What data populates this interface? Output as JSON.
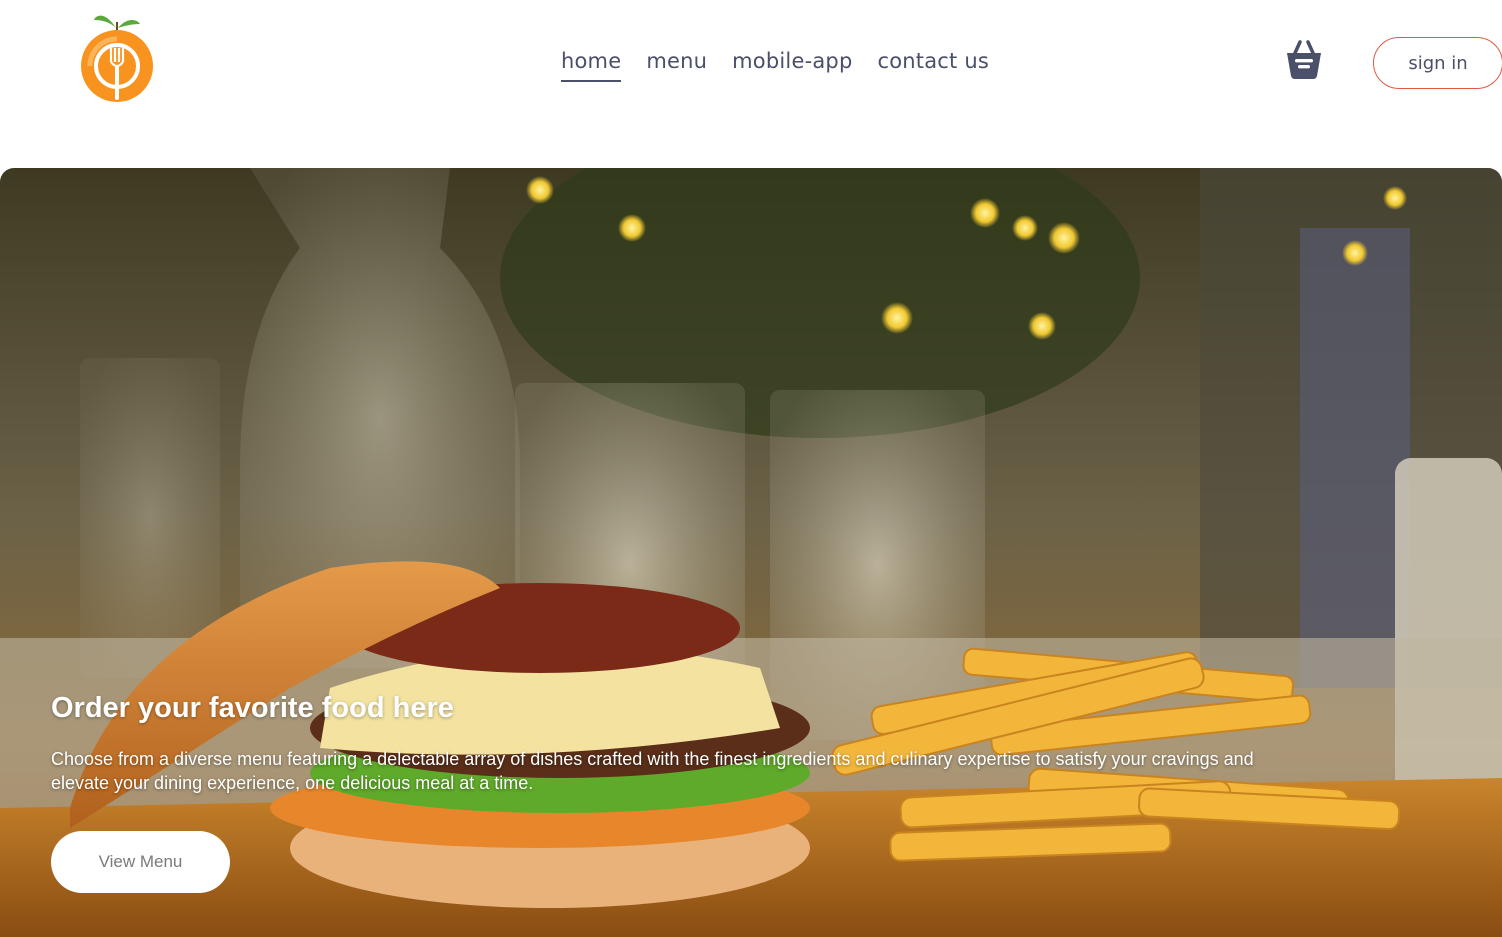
{
  "nav": {
    "links": [
      {
        "label": "home",
        "active": true
      },
      {
        "label": "menu",
        "active": false
      },
      {
        "label": "mobile-app",
        "active": false
      },
      {
        "label": "contact us",
        "active": false
      }
    ],
    "basket_icon": "basket-icon",
    "signin_label": "sign in",
    "signin_border_color": "#e05a42"
  },
  "brand": {
    "logo_icon": "orange-fork-logo",
    "accent_color": "#f7931e"
  },
  "hero": {
    "title": "Order your favorite food here",
    "description": "Choose from a diverse menu featuring a delectable array of dishes crafted with the finest ingredients and culinary expertise to satisfy your cravings and elevate your dining experience, one delicious meal at a time.",
    "button_label": "View Menu"
  },
  "colors": {
    "nav_text": "#4a4f6a",
    "hero_text": "#ffffff"
  }
}
